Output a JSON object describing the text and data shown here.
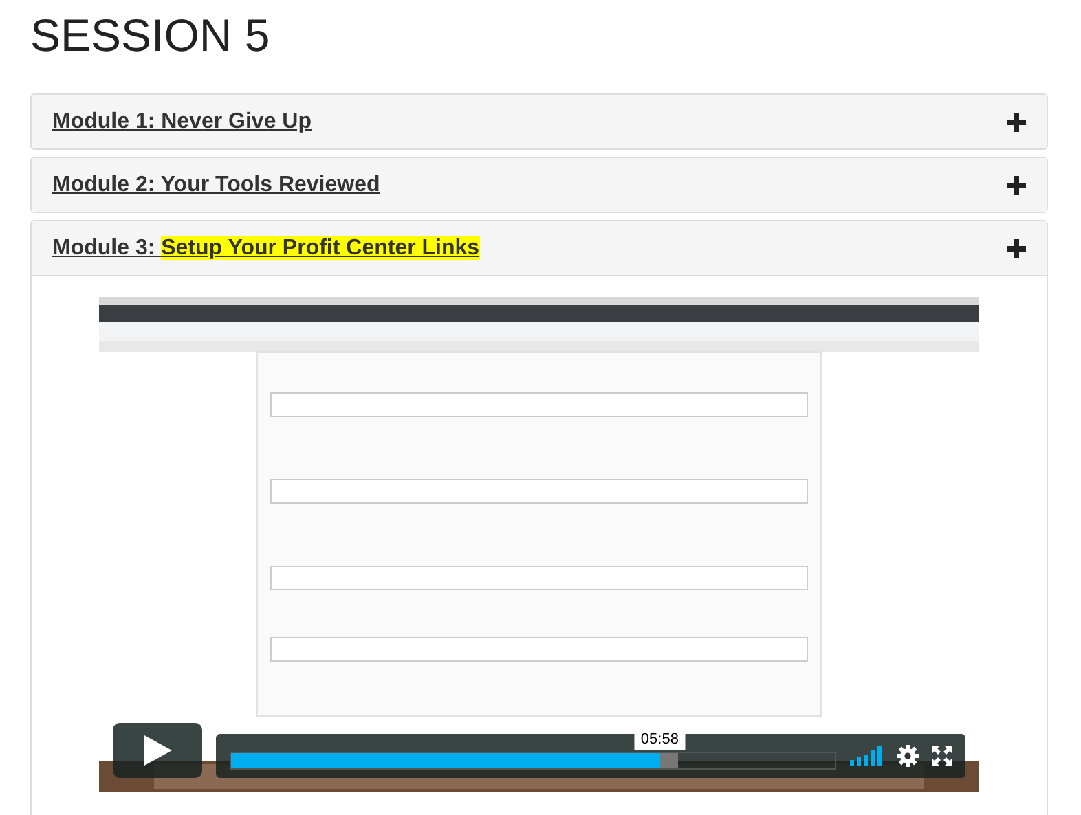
{
  "page_title": "SESSION 5",
  "modules": [
    {
      "title": "Module 1: Never Give Up",
      "expanded": false
    },
    {
      "title": "Module 2: Your Tools Reviewed",
      "expanded": false
    },
    {
      "title": "Module 3: ",
      "highlight": "Setup Your Profit Center Links",
      "expanded": true,
      "video": {
        "kind": "picture",
        "time_tooltip": "05:58",
        "progress": {
          "level": 0.71
        },
        "buffer": {
          "level": 0.74
        }
      }
    }
  ]
}
